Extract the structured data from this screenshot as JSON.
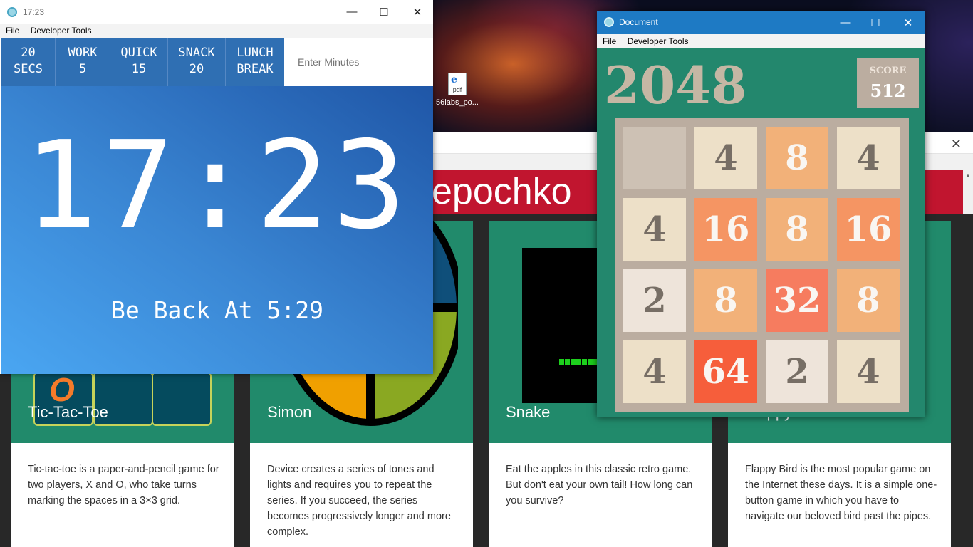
{
  "desktop": {
    "icon_label": "56labs_po...",
    "icon_type": "pdf"
  },
  "browser": {
    "banner_text": "epochko",
    "cards": [
      {
        "title": "Tic-Tac-Toe",
        "description": "Tic-tac-toe is a paper-and-pencil game for two players, X and O, who take turns marking the spaces in a 3×3 grid.",
        "mark": "O"
      },
      {
        "title": "Simon",
        "description": "Device creates a series of tones and lights and requires you to repeat the series. If you succeed, the series becomes progressively longer and more complex."
      },
      {
        "title": "Snake",
        "description": "Eat the apples in this classic retro game. But don't eat your own tail! How long can you survive?"
      },
      {
        "title": "Flappy Bird",
        "description": "Flappy Bird is the most popular game on the Internet these days. It is a simple one-button game in which you have to navigate our beloved bird past the pipes."
      }
    ]
  },
  "timer_window": {
    "title": "17:23",
    "menu": [
      "File",
      "Developer Tools"
    ],
    "presets": [
      {
        "line1": "20",
        "line2": "SECS"
      },
      {
        "line1": "WORK",
        "line2": "5"
      },
      {
        "line1": "QUICK",
        "line2": "15"
      },
      {
        "line1": "SNACK",
        "line2": "20"
      },
      {
        "line1": "LUNCH",
        "line2": "BREAK"
      }
    ],
    "minutes_placeholder": "Enter Minutes",
    "clock": "17:23",
    "be_back": "Be Back At 5:29"
  },
  "game_window": {
    "title": "Document",
    "menu": [
      "File",
      "Developer Tools"
    ],
    "game_title": "2048",
    "score_label": "SCORE",
    "score": "512",
    "grid": [
      [
        "",
        "4",
        "8",
        "4"
      ],
      [
        "4",
        "16",
        "8",
        "16"
      ],
      [
        "2",
        "8",
        "32",
        "8"
      ],
      [
        "4",
        "64",
        "2",
        "4"
      ]
    ],
    "tile_colors": {
      "empty": "#cdc1b4",
      "2": "#eee4da",
      "4": "#ede0c8",
      "8": "#f2b179",
      "16": "#f59563",
      "32": "#f67c5f",
      "64": "#f65e3b"
    }
  },
  "colors": {
    "timer_blue": "#2f6fb3",
    "card_green": "#218a6b",
    "banner_red": "#c1152f",
    "game_bg": "#23876d",
    "titlebar_active": "#1e7ac4"
  }
}
